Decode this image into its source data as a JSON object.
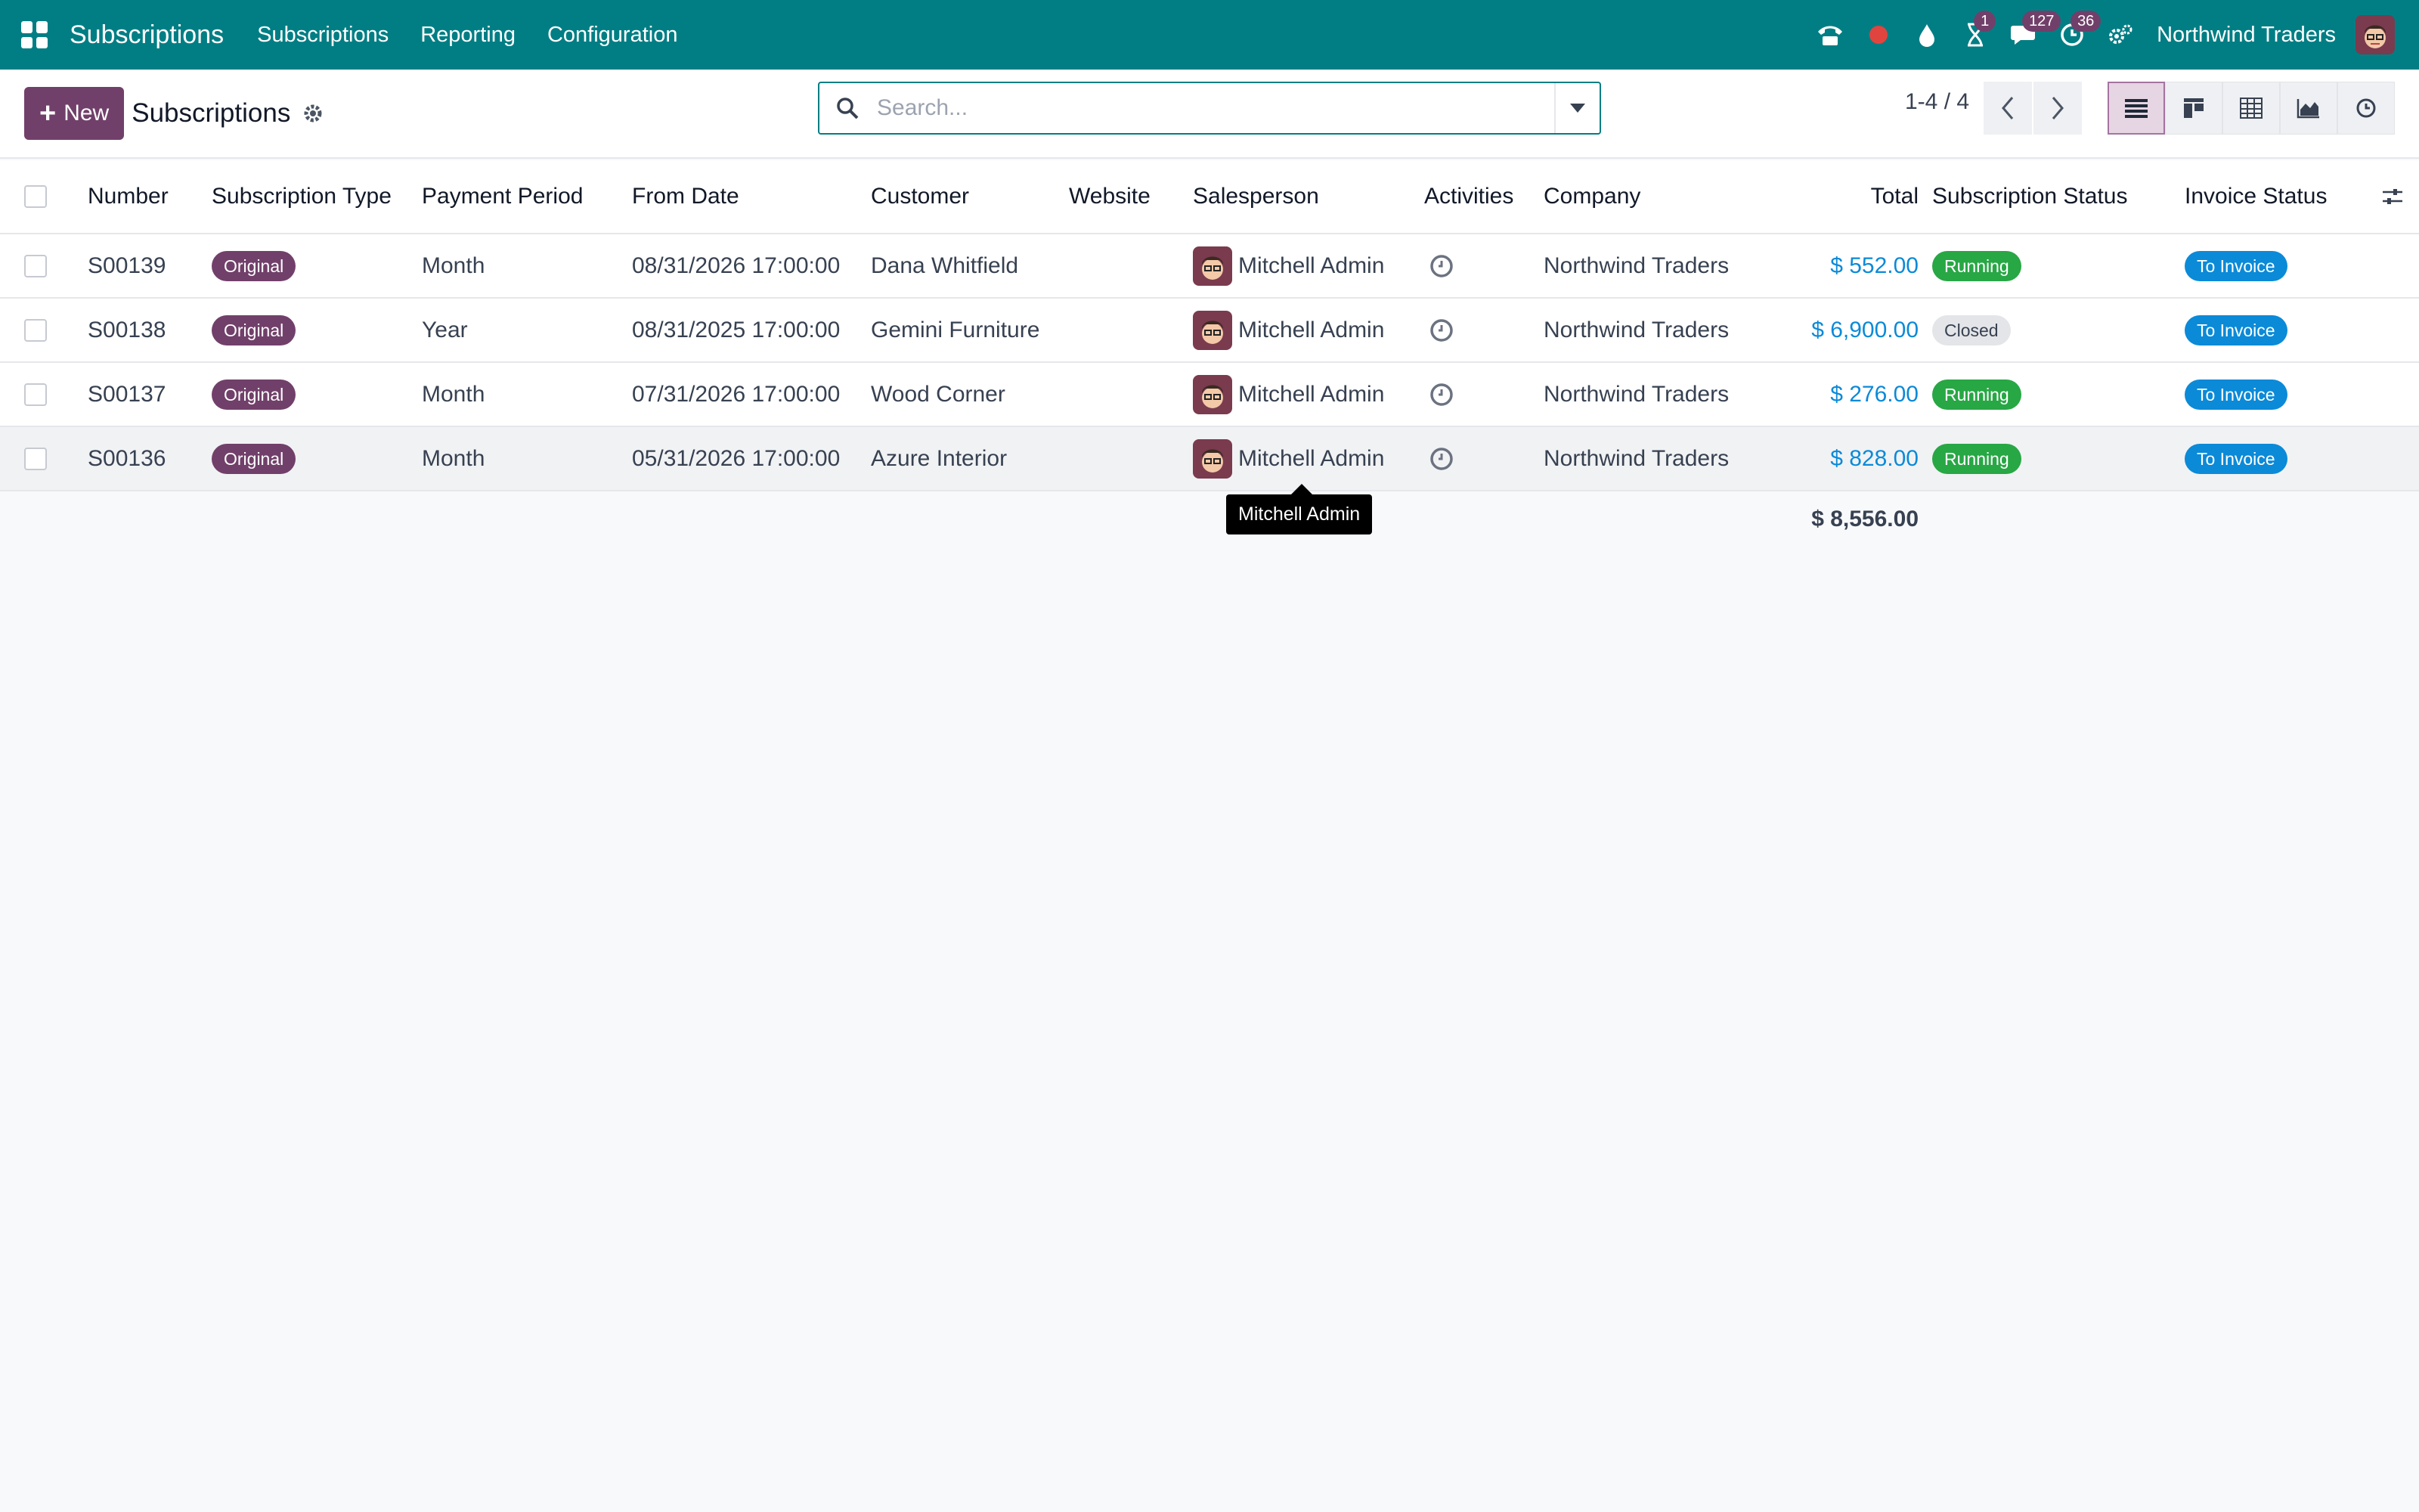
{
  "navbar": {
    "brand": "Subscriptions",
    "menus": [
      "Subscriptions",
      "Reporting",
      "Configuration"
    ],
    "icons": [
      "phone-icon",
      "record-dot-icon",
      "drop-icon",
      "hourglass-icon",
      "chat-icon",
      "clock-icon",
      "settings-icon"
    ],
    "badges": {
      "hourglass": "1",
      "chat": "127",
      "clock": "36"
    },
    "company": "Northwind Traders"
  },
  "control": {
    "new_label": "New",
    "title": "Subscriptions",
    "search_placeholder": "Search...",
    "pager": "1-4 / 4"
  },
  "table": {
    "columns": [
      "Number",
      "Subscription Type",
      "Payment Period",
      "From Date",
      "Customer",
      "Website",
      "Salesperson",
      "Activities",
      "Company",
      "Total",
      "Subscription Status",
      "Invoice Status"
    ],
    "rows": [
      {
        "number": "S00139",
        "type": "Original",
        "period": "Month",
        "from_date": "08/31/2026 17:00:00",
        "customer": "Dana Whitfield",
        "website": "",
        "salesperson": "Mitchell Admin",
        "company": "Northwind Traders",
        "total": "$ 552.00",
        "status": "Running",
        "invoice": "To Invoice"
      },
      {
        "number": "S00138",
        "type": "Original",
        "period": "Year",
        "from_date": "08/31/2025 17:00:00",
        "customer": "Gemini Furniture",
        "website": "",
        "salesperson": "Mitchell Admin",
        "company": "Northwind Traders",
        "total": "$ 6,900.00",
        "status": "Closed",
        "invoice": "To Invoice"
      },
      {
        "number": "S00137",
        "type": "Original",
        "period": "Month",
        "from_date": "07/31/2026 17:00:00",
        "customer": "Wood Corner",
        "website": "",
        "salesperson": "Mitchell Admin",
        "company": "Northwind Traders",
        "total": "$ 276.00",
        "status": "Running",
        "invoice": "To Invoice"
      },
      {
        "number": "S00136",
        "type": "Original",
        "period": "Month",
        "from_date": "05/31/2026 17:00:00",
        "customer": "Azure Interior",
        "website": "",
        "salesperson": "Mitchell Admin",
        "company": "Northwind Traders",
        "total": "$ 828.00",
        "status": "Running",
        "invoice": "To Invoice"
      }
    ],
    "grand_total": "$ 8,556.00"
  },
  "tooltip": "Mitchell Admin",
  "colors": {
    "navbar": "#017e84",
    "primary": "#71406a",
    "running": "#28a745",
    "invoice": "#0b8ad8"
  }
}
